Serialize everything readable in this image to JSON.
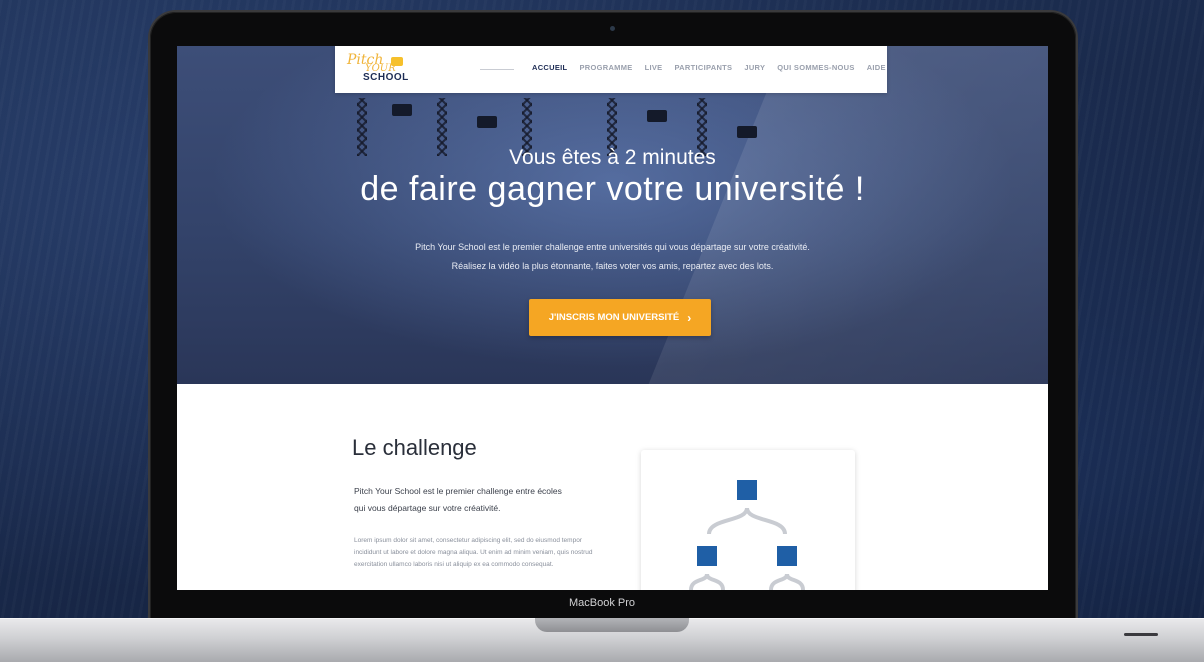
{
  "site": {
    "logo": {
      "line1": "Pitch",
      "line2": "YOUR",
      "line3": "SCHOOL"
    },
    "nav": [
      {
        "label": "ACCUEIL",
        "active": true
      },
      {
        "label": "PROGRAMME"
      },
      {
        "label": "LIVE"
      },
      {
        "label": "PARTICIPANTS"
      },
      {
        "label": "JURY"
      },
      {
        "label": "QUI SOMMES-NOUS"
      },
      {
        "label": "AIDE"
      }
    ],
    "hero": {
      "headline_small": "Vous êtes à 2 minutes",
      "headline_large": "de faire gagner votre université !",
      "sub_line1": "Pitch Your School est le premier challenge entre universités qui vous départage sur votre créativité.",
      "sub_line2": "Réalisez la vidéo la plus étonnante, faites voter vos amis, repartez avec des lots.",
      "cta_label": "J'INSCRIS MON UNIVERSITÉ",
      "cta_icon": "chevron-right-icon"
    },
    "challenge": {
      "title": "Le challenge",
      "lead": "Pitch Your School est le premier challenge entre écoles qui vous départage sur votre créativité.",
      "lorem": "Lorem ipsum dolor sit amet, consectetur adipiscing elit, sed do eiusmod tempor incididunt ut labore et dolore magna aliqua. Ut enim ad minim veniam, quis nostrud exercitation ullamco laboris nisi ut aliquip ex ea commodo consequat."
    }
  },
  "device": {
    "model": "MacBook Pro"
  },
  "colors": {
    "accent": "#f5a623",
    "brand_navy": "#1e2d55",
    "diagram_blue": "#1f5fa6"
  }
}
